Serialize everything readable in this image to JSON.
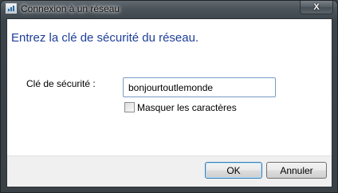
{
  "window": {
    "title": "Connexion à un réseau",
    "close_label": "X"
  },
  "main": {
    "heading": "Entrez la clé de sécurité du réseau.",
    "security_key_label": "Clé de sécurité :",
    "security_key_value": "bonjourtoutlemonde",
    "hide_characters_label": "Masquer les caractères",
    "hide_characters_checked": false
  },
  "footer": {
    "ok_label": "OK",
    "cancel_label": "Annuler"
  },
  "colors": {
    "heading": "#1e3e9a",
    "titlebar": "#4c545b",
    "default_button_border": "#3c7fb1"
  }
}
